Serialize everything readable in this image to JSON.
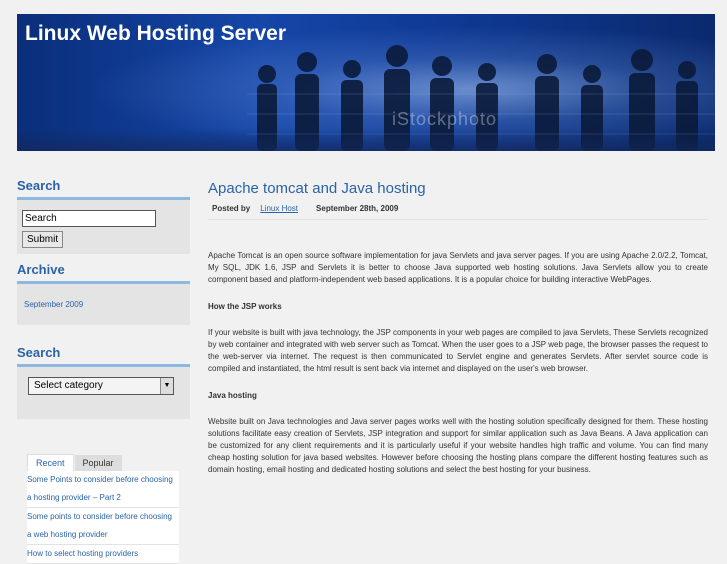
{
  "site": {
    "title": "Linux Web Hosting Server",
    "watermark": "iStockphoto"
  },
  "sidebar": {
    "search_title": "Search",
    "search_value": "Search",
    "submit_label": "Submit",
    "archive_title": "Archive",
    "archive_items": [
      "September 2009"
    ],
    "category_title": "Search",
    "category_select": "Select category",
    "tabs": [
      "Recent",
      "Popular"
    ],
    "recent_posts": [
      "Some Points to consider before choosing",
      "a hosting provider – Part 2",
      "Some points to consider before choosing",
      "a web hosting provider",
      "How to select hosting providers"
    ]
  },
  "post": {
    "title": "Apache tomcat and Java hosting",
    "posted_by_label": "Posted by",
    "author": "Linux Host",
    "date": "September 28th, 2009",
    "paragraph1": "Apache Tomcat is an open source software implementation for java Servlets and java server pages. If you are using Apache 2.0/2.2, Tomcat, My SQL, JDK 1.6, JSP and Servlets it is better to choose Java supported web hosting solutions. Java Servlets allow you to create component based and platform-independent web based applications. It is a popular choice for building interactive WebPages.",
    "subhead1": "How the JSP works",
    "paragraph2": "If your website is built with java technology, the JSP components in your web pages are compiled to java Servlets, These Servlets recognized by web container and integrated with web server such as Tomcat. When the user goes to a JSP web page, the browser passes the request to the web-server via internet. The request is then communicated to Servlet engine and generates Servlets. After servlet source code is compiled and instantiated, the html result is sent back via internet and displayed on the user's web browser.",
    "subhead2": "Java hosting",
    "paragraph3": "Website built on Java technologies and Java server pages works well with the hosting solution specifically designed for them. These hosting solutions facilitate easy creation of Servlets, JSP integration and support for similar application such as Java Beans. A Java application can be customized for any client requirements and it is particularly useful if your website handles high traffic and volume. You can find many cheap hosting solution for java based websites. However before choosing the hosting plans compare the different hosting features such as domain hosting, email hosting and dedicated hosting solutions and select the best hosting for your business."
  }
}
